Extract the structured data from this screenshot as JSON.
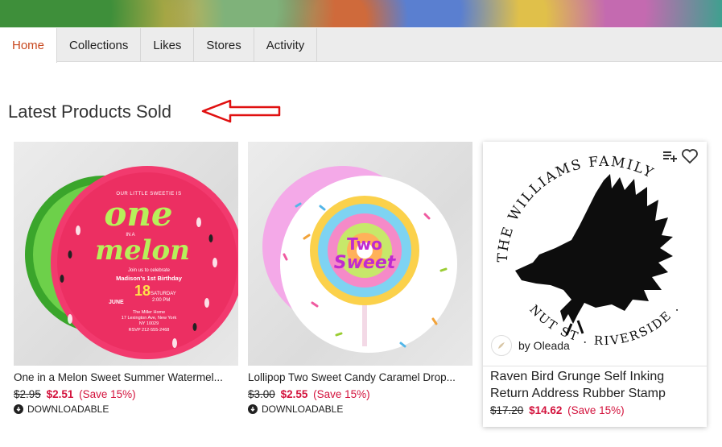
{
  "tabs": [
    {
      "label": "Home"
    },
    {
      "label": "Collections"
    },
    {
      "label": "Likes"
    },
    {
      "label": "Stores"
    },
    {
      "label": "Activity"
    }
  ],
  "section_title": "Latest Products Sold",
  "products": [
    {
      "title": "One in a Melon Sweet Summer Watermel...",
      "old_price": "$2.95",
      "new_price": "$2.51",
      "save": "(Save 15%)",
      "badge": "DOWNLOADABLE",
      "art": {
        "small_top": "OUR LITTLE SWEETIE IS",
        "big1": "one",
        "in_a": "IN A",
        "big2": "melon",
        "join": "Join us to celebrate",
        "name": "Madison's 1st Birthday",
        "date": "18",
        "month": "JUNE",
        "day": "SATURDAY",
        "time": "2:00 PM",
        "addr1": "The Miller Home",
        "addr2": "17 Lexington Ave, New York",
        "addr3": "NY 10029",
        "rsvp": "RSVP 212-555-2468"
      }
    },
    {
      "title": "Lollipop Two Sweet Candy Caramel Drop...",
      "old_price": "$3.00",
      "new_price": "$2.55",
      "save": "(Save 15%)",
      "badge": "DOWNLOADABLE",
      "art": {
        "line1": "Two",
        "line2": "Sweet"
      }
    },
    {
      "title": "Raven Bird Grunge Self Inking Return Address Rubber Stamp",
      "old_price": "$17.20",
      "new_price": "$14.62",
      "save": "(Save 15%)",
      "byline": "by Oleada",
      "art": {
        "arc_top": "THE WILLIAMS FAMILY",
        "arc_bottom": "NUT ST . RIVERSIDE ."
      }
    }
  ],
  "colors": {
    "accent": "#c8481e",
    "sale": "#d3123c",
    "annotation": "#e01010"
  },
  "icons": [
    "add-to-collection-icon",
    "heart-icon",
    "download-icon",
    "arrow-annotation-icon"
  ]
}
